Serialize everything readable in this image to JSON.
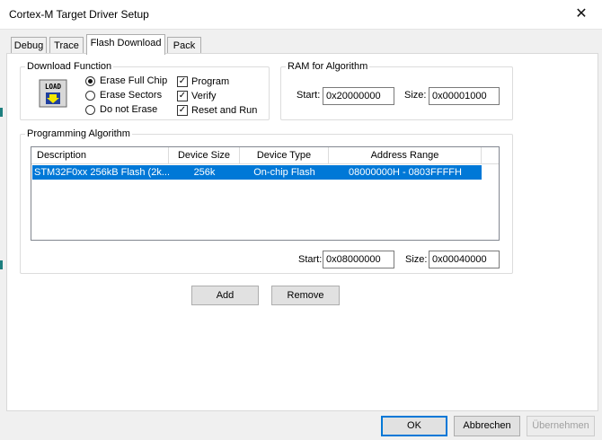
{
  "window": {
    "title": "Cortex-M Target Driver Setup",
    "close_glyph": "✕"
  },
  "tabs": [
    {
      "label": "Debug"
    },
    {
      "label": "Trace"
    },
    {
      "label": "Flash Download"
    },
    {
      "label": "Pack"
    }
  ],
  "download_function": {
    "title": "Download Function",
    "options": [
      "Erase Full Chip",
      "Erase Sectors",
      "Do not Erase"
    ],
    "selected_option": "Erase Full Chip",
    "checks": [
      {
        "label": "Program",
        "checked": true
      },
      {
        "label": "Verify",
        "checked": true
      },
      {
        "label": "Reset and Run",
        "checked": true
      }
    ],
    "icon_text": "LOAD"
  },
  "ram_for_algorithm": {
    "title": "RAM for Algorithm",
    "start_label": "Start:",
    "start_value": "0x20000000",
    "size_label": "Size:",
    "size_value": "0x00001000"
  },
  "programming_algorithm": {
    "title": "Programming Algorithm",
    "columns": [
      "Description",
      "Device Size",
      "Device Type",
      "Address Range"
    ],
    "rows": [
      {
        "description": "STM32F0xx 256kB Flash (2k...",
        "device_size": "256k",
        "device_type": "On-chip Flash",
        "address_range": "08000000H - 0803FFFFH"
      }
    ],
    "start_label": "Start:",
    "start_value": "0x08000000",
    "size_label": "Size:",
    "size_value": "0x00040000"
  },
  "buttons": {
    "add": "Add",
    "remove": "Remove",
    "ok": "OK",
    "cancel": "Abbrechen",
    "apply": "Übernehmen"
  },
  "colors": {
    "selection": "#0078d7",
    "default_button_border": "#0078d7"
  }
}
